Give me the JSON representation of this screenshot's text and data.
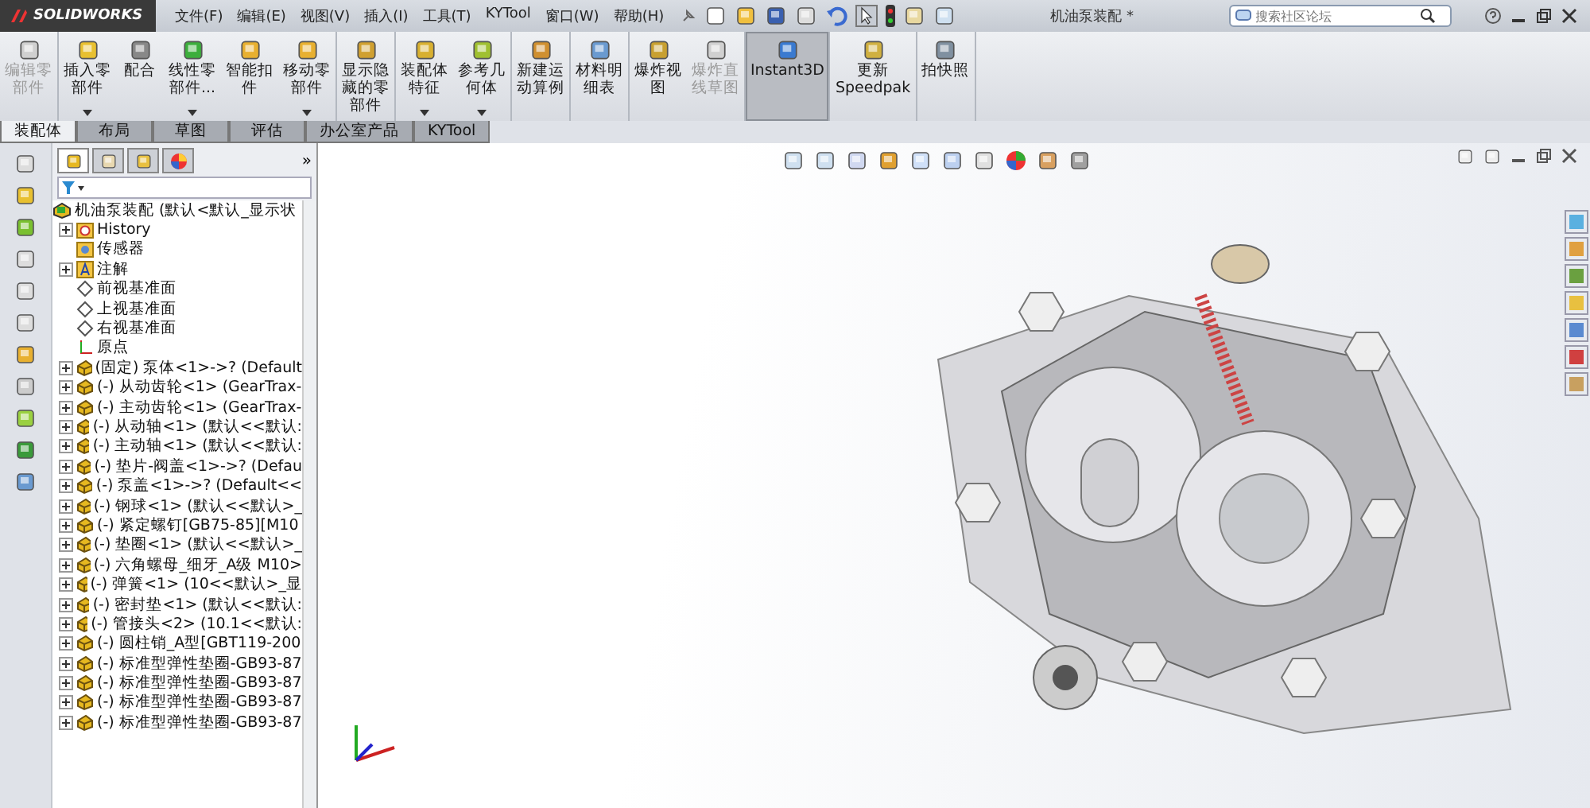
{
  "app": {
    "logo": "SOLIDWORKS",
    "title": "机油泵装配 *"
  },
  "menu": [
    "文件(F)",
    "编辑(E)",
    "视图(V)",
    "插入(I)",
    "工具(T)",
    "KYTool",
    "窗口(W)",
    "帮助(H)"
  ],
  "search": {
    "placeholder": "搜索社区论坛"
  },
  "toolbar_groups": [
    [
      {
        "lines": [
          "编辑零",
          "部件"
        ],
        "disabled": true,
        "selected": false,
        "dropdown": false
      }
    ],
    [
      {
        "lines": [
          "插入零",
          "部件"
        ],
        "disabled": false,
        "selected": false,
        "dropdown": true
      },
      {
        "lines": [
          "配合"
        ],
        "disabled": false,
        "selected": false,
        "dropdown": false
      },
      {
        "lines": [
          "线性零",
          "部件..."
        ],
        "disabled": false,
        "selected": false,
        "dropdown": true
      },
      {
        "lines": [
          "智能扣",
          "件"
        ],
        "disabled": false,
        "selected": false,
        "dropdown": false
      },
      {
        "lines": [
          "移动零",
          "部件"
        ],
        "disabled": false,
        "selected": false,
        "dropdown": true
      }
    ],
    [
      {
        "lines": [
          "显示隐",
          "藏的零",
          "部件"
        ],
        "disabled": false,
        "selected": false,
        "dropdown": false
      }
    ],
    [
      {
        "lines": [
          "装配体",
          "特征"
        ],
        "disabled": false,
        "selected": false,
        "dropdown": true
      },
      {
        "lines": [
          "参考几",
          "何体"
        ],
        "disabled": false,
        "selected": false,
        "dropdown": true
      }
    ],
    [
      {
        "lines": [
          "新建运",
          "动算例"
        ],
        "disabled": false,
        "selected": false,
        "dropdown": false
      }
    ],
    [
      {
        "lines": [
          "材料明",
          "细表"
        ],
        "disabled": false,
        "selected": false,
        "dropdown": false
      }
    ],
    [
      {
        "lines": [
          "爆炸视",
          "图"
        ],
        "disabled": false,
        "selected": false,
        "dropdown": false
      },
      {
        "lines": [
          "爆炸直",
          "线草图"
        ],
        "disabled": true,
        "selected": false,
        "dropdown": false
      }
    ],
    [
      {
        "lines": [
          "Instant3D"
        ],
        "disabled": false,
        "selected": true,
        "dropdown": false
      }
    ],
    [
      {
        "lines": [
          "更新",
          "Speedpak"
        ],
        "disabled": false,
        "selected": false,
        "dropdown": false
      }
    ],
    [
      {
        "lines": [
          "拍快照"
        ],
        "disabled": false,
        "selected": false,
        "dropdown": false
      }
    ]
  ],
  "tabs": [
    {
      "label": "装配体",
      "selected": true
    },
    {
      "label": "布局",
      "selected": false
    },
    {
      "label": "草图",
      "selected": false
    },
    {
      "label": "评估",
      "selected": false
    },
    {
      "label": "办公室产品",
      "selected": false
    },
    {
      "label": "KYTool",
      "selected": false
    }
  ],
  "panel": {
    "more": "»"
  },
  "tree": {
    "root": "机油泵装配  (默认<默认_显示状",
    "children": [
      {
        "kind": "history",
        "label": "History",
        "expandable": true
      },
      {
        "kind": "sensor",
        "label": "传感器",
        "expandable": false
      },
      {
        "kind": "annotation",
        "label": "注解",
        "expandable": true
      },
      {
        "kind": "plane",
        "label": "前视基准面",
        "expandable": false
      },
      {
        "kind": "plane",
        "label": "上视基准面",
        "expandable": false
      },
      {
        "kind": "plane",
        "label": "右视基准面",
        "expandable": false
      },
      {
        "kind": "origin",
        "label": "原点",
        "expandable": false
      },
      {
        "kind": "part",
        "label": "(固定) 泵体<1>->? (Default",
        "expandable": true
      },
      {
        "kind": "part",
        "label": "(-) 从动齿轮<1> (GearTrax-",
        "expandable": true
      },
      {
        "kind": "part",
        "label": "(-) 主动齿轮<1> (GearTrax-",
        "expandable": true
      },
      {
        "kind": "part",
        "label": "(-) 从动轴<1> (默认<<默认:",
        "expandable": true
      },
      {
        "kind": "part",
        "label": "(-) 主动轴<1> (默认<<默认:",
        "expandable": true
      },
      {
        "kind": "part",
        "label": "(-) 垫片-阀盖<1>->? (Defau",
        "expandable": true
      },
      {
        "kind": "part",
        "label": "(-) 泵盖<1>->? (Default<<",
        "expandable": true
      },
      {
        "kind": "part",
        "label": "(-) 钢球<1> (默认<<默认>_",
        "expandable": true
      },
      {
        "kind": "part",
        "label": "(-) 紧定螺钉[GB75-85][M10",
        "expandable": true
      },
      {
        "kind": "part",
        "label": "(-) 垫圈<1> (默认<<默认>_",
        "expandable": true
      },
      {
        "kind": "part",
        "label": "(-) 六角螺母_细牙_A级 M10>",
        "expandable": true
      },
      {
        "kind": "part",
        "label": "(-) 弹簧<1> (10<<默认>_显",
        "expandable": true
      },
      {
        "kind": "part",
        "label": "(-) 密封垫<1> (默认<<默认:",
        "expandable": true
      },
      {
        "kind": "part",
        "label": "(-) 管接头<2> (10.1<<默认:",
        "expandable": true
      },
      {
        "kind": "part",
        "label": "(-) 圆柱销_A型[GBT119-200",
        "expandable": true
      },
      {
        "kind": "part",
        "label": "(-) 标准型弹性垫圈-GB93-87",
        "expandable": true
      },
      {
        "kind": "part",
        "label": "(-) 标准型弹性垫圈-GB93-87",
        "expandable": true
      },
      {
        "kind": "part",
        "label": "(-) 标准型弹性垫圈-GB93-87",
        "expandable": true
      },
      {
        "kind": "part",
        "label": "(-) 标准型弹性垫圈-GB93-87",
        "expandable": true
      }
    ]
  }
}
